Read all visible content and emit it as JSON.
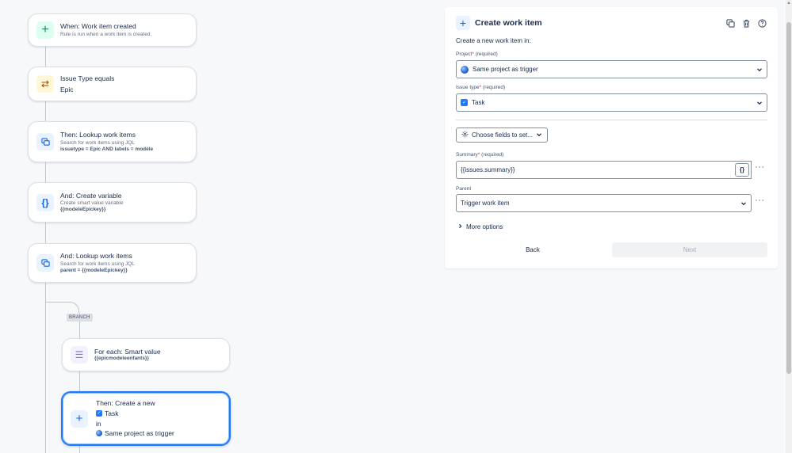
{
  "flow": {
    "trigger": {
      "title": "When: Work item created",
      "subtitle": "Rule is run when a work item is created."
    },
    "condition": {
      "title": "Issue Type equals",
      "value": "Epic"
    },
    "lookup1": {
      "title": "Then: Lookup work items",
      "subtitle": "Search for work items using JQL",
      "query": "issuetype = Epic AND labels = modèle"
    },
    "variable": {
      "title": "And: Create variable",
      "subtitle": "Create smart value variable",
      "value": "{{modeleEpickey}}"
    },
    "lookup2": {
      "title": "And: Lookup work items",
      "subtitle": "Search for work items using JQL",
      "query": "parent = {{modeleEpickey}}"
    },
    "branch_label": "BRANCH",
    "foreach": {
      "title": "For each: Smart value",
      "value": "{{epicmodeleenfants}}"
    },
    "create": {
      "title": "Then: Create a new",
      "type": "Task",
      "connector": "in",
      "project": "Same project as trigger"
    }
  },
  "panel": {
    "title": "Create work item",
    "intro": "Create a new work item in:",
    "project": {
      "label": "Project",
      "required_mark": "*",
      "required_text": "(required)",
      "value": "Same project as trigger"
    },
    "issue_type": {
      "label": "Issue type",
      "required_mark": "*",
      "required_text": "(required)",
      "value": "Task"
    },
    "choose_fields": "Choose fields to set...",
    "summary": {
      "label": "Summary",
      "required_mark": "*",
      "required_text": "(required)",
      "value": "{{issues.summary}}"
    },
    "parent": {
      "label": "Parent",
      "value": "Trigger work item"
    },
    "smart_value_button": "{}",
    "more_options": "More options",
    "back": "Back",
    "next": "Next"
  },
  "colors": {
    "accent": "#1d7afc",
    "required": "#c9372c",
    "disabled_text": "#a5adba"
  }
}
